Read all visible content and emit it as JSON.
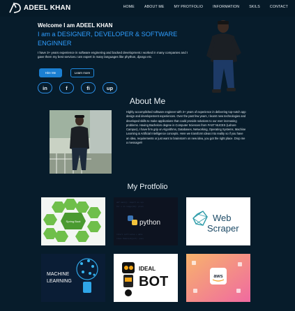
{
  "nav": {
    "brand": "ADEEL KHAN",
    "links": [
      "HOME",
      "ABOUT ME",
      "MY PROTFOLIO",
      "INFORMATION",
      "SKILS",
      "CONTACT"
    ]
  },
  "hero": {
    "welcome": "Welcome I am ADEEL KHAN",
    "role": "I am a DESIGNER, DEVELOPER & SOFTWARE ENGINNER",
    "intro": "I have 3+ years experience in software enginering and backed development.I worked in many companies and I gave them my best services.I am expert in many languages like phython, django etc.",
    "hire_button": "Hire Me",
    "more_button": "Learn more",
    "socials": [
      "in",
      "f",
      "fi",
      "up"
    ]
  },
  "about": {
    "title": "About Me",
    "text": "Highly accomplished software engineer with 3+ years of experience in delivering top-notch app design and developement experiences. Over the past few years, I learnt new technologies and developed skills to make applications that could provide solutions to our ever increasing problems. Having Bachelors degree in Computer Sciences from FAST NUCES (Lahore Campus), I have firm grip on Algorithms, Databases, Networking, Operating Systems, Machine Learning & Artificial Intelligence concepts. Here we transform ideas into reality so if you have an idea, requirements or just want to brainstorm on new idea, you got the right place. Drop me a message!!!"
  },
  "portfolio": {
    "title": "My Protfolio",
    "cards": [
      {
        "label": "Spring Boot"
      },
      {
        "label": "python"
      },
      {
        "label_top": "Web",
        "label_bottom": "Scraper"
      },
      {
        "label_top": "MACHINE",
        "label_bottom": "LEARNING"
      },
      {
        "label_top": "IDEAL",
        "label_bottom": "BOT"
      },
      {
        "label": "aws"
      }
    ]
  },
  "colors": {
    "background": "#071c2b",
    "accent": "#2f9eff"
  }
}
